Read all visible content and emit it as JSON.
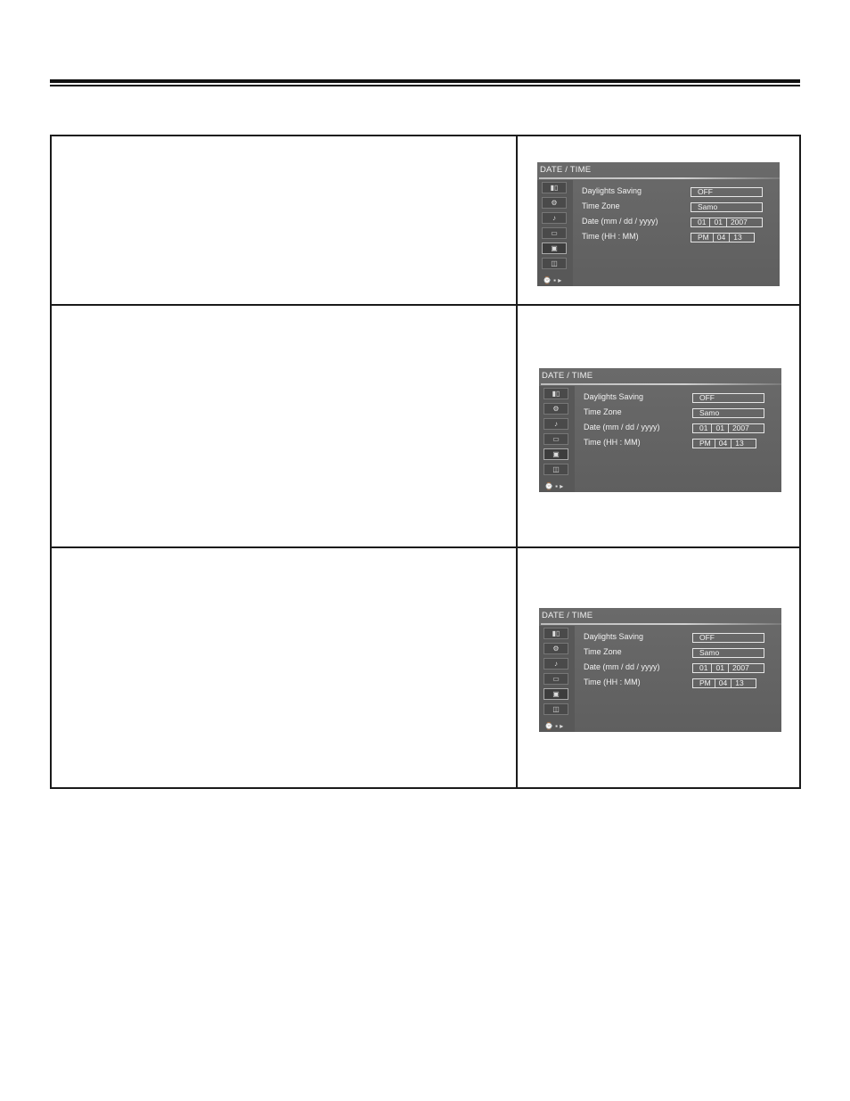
{
  "screen": {
    "title": "DATE / TIME",
    "labels": {
      "daylight": "Daylights Saving",
      "timezone": "Time Zone",
      "date": "Date (mm / dd / yyyy)",
      "time": "Time (HH : MM)"
    },
    "values": {
      "daylight": "OFF",
      "timezone": "Samo",
      "month": "01",
      "day": "01",
      "year": "2007",
      "ampm": "PM",
      "hour": "04",
      "minute": "13"
    },
    "icons": [
      "display-icon",
      "setup-icon",
      "audio-icon",
      "screen-icon",
      "camera-icon",
      "disc-icon",
      "clock-icon"
    ]
  },
  "colors": {
    "screen_bg": "#646464",
    "text": "#f2f2f2"
  }
}
